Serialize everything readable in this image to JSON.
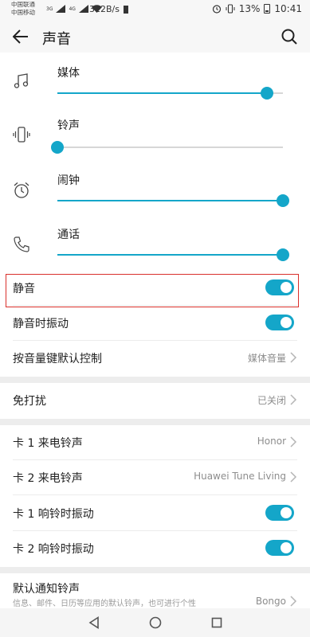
{
  "status_bar": {
    "carrier1": "中国联通",
    "carrier2": "中国移动",
    "net_badge": "3G",
    "net_badge2": "4G",
    "speed": "312B/s",
    "battery": "13%",
    "time": "10:41"
  },
  "app_bar": {
    "title": "声音"
  },
  "volumes": [
    {
      "label": "媒体",
      "icon": "music-note-icon",
      "level": 0.93
    },
    {
      "label": "铃声",
      "icon": "vibrate-icon",
      "level": 0.0
    },
    {
      "label": "闹钟",
      "icon": "alarm-clock-icon",
      "level": 1.0
    },
    {
      "label": "通话",
      "icon": "phone-icon",
      "level": 1.0
    }
  ],
  "toggles": {
    "silent": {
      "label": "静音",
      "on": true
    },
    "silent_vibrate": {
      "label": "静音时振动",
      "on": true
    },
    "volume_key": {
      "label": "按音量键默认控制",
      "value": "媒体音量"
    }
  },
  "dnd": {
    "label": "免打扰",
    "value": "已关闭"
  },
  "rings": {
    "sim1_ringtone": {
      "label": "卡 1 来电铃声",
      "value": "Honor"
    },
    "sim2_ringtone": {
      "label": "卡 2 来电铃声",
      "value": "Huawei Tune Living"
    },
    "sim1_vibrate": {
      "label": "卡 1 响铃时振动",
      "on": true
    },
    "sim2_vibrate": {
      "label": "卡 2 响铃时振动",
      "on": true
    }
  },
  "notify": {
    "title": "默认通知铃声",
    "subtitle": "信息、邮件、日历等应用的默认铃声，也可进行个性",
    "value": "Bongo"
  },
  "colors": {
    "accent": "#14a6c9",
    "highlight_border": "#d9302b",
    "background": "#ededed"
  }
}
